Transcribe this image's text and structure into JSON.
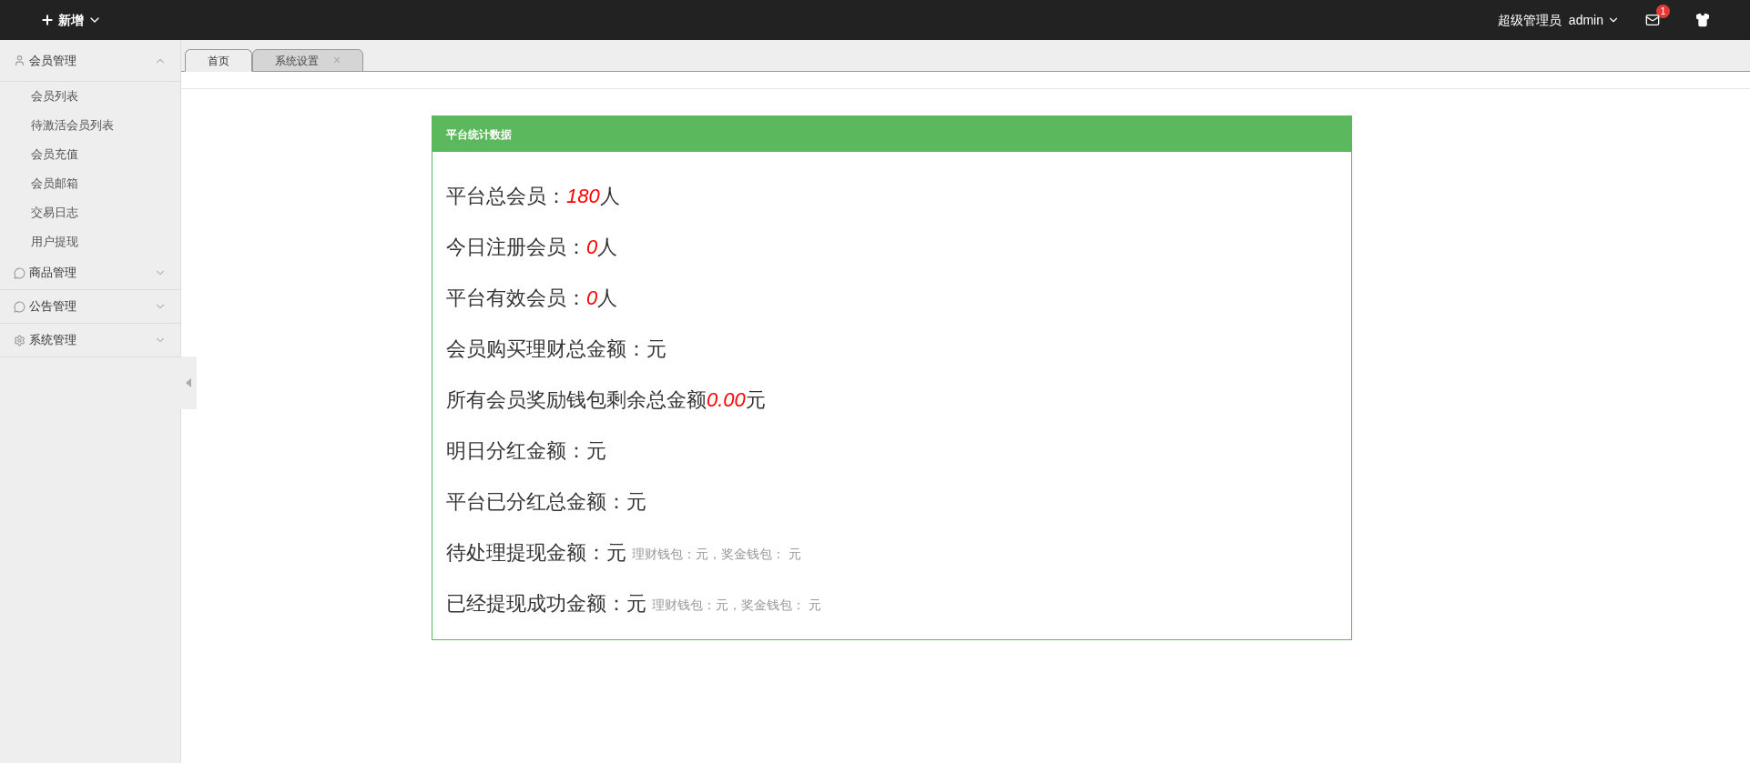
{
  "topbar": {
    "new_button": "新增",
    "role": "超级管理员",
    "user": "admin",
    "mail_badge": "1"
  },
  "sidebar": {
    "groups": [
      {
        "label": "会员管理",
        "kind": "user",
        "expanded": true,
        "items": [
          "会员列表",
          "待激活会员列表",
          "会员充值",
          "会员邮箱",
          "交易日志",
          "用户提现"
        ]
      },
      {
        "label": "商品管理",
        "kind": "chat",
        "expanded": false
      },
      {
        "label": "公告管理",
        "kind": "chat",
        "expanded": false
      },
      {
        "label": "系统管理",
        "kind": "gear",
        "expanded": false
      }
    ]
  },
  "tabs": [
    {
      "label": "首页",
      "selected": true
    },
    {
      "label": "系统设置",
      "selected": false,
      "close": "×"
    }
  ],
  "panel": {
    "title": "平台统计数据",
    "stats": [
      {
        "label": "平台总会员：",
        "value": "180",
        "unit": "人"
      },
      {
        "label": "今日注册会员：",
        "value": "0",
        "unit": "人"
      },
      {
        "label": "平台有效会员：",
        "value": "0",
        "unit": "人"
      },
      {
        "label": "会员购买理财总金额：",
        "unit": "元"
      },
      {
        "label": "所有会员奖励钱包剩余总金额",
        "value": "0.00",
        "unit": "元"
      },
      {
        "label": "明日分红金额：",
        "unit": "元"
      },
      {
        "label": "平台已分红总金额：",
        "unit": "元"
      },
      {
        "label": "待处理提现金额：",
        "unit": "元",
        "note": "理财钱包：元，奖金钱包： 元"
      },
      {
        "label": "已经提现成功金额：",
        "unit": "元",
        "note": "理财钱包：元，奖金钱包： 元"
      }
    ]
  }
}
